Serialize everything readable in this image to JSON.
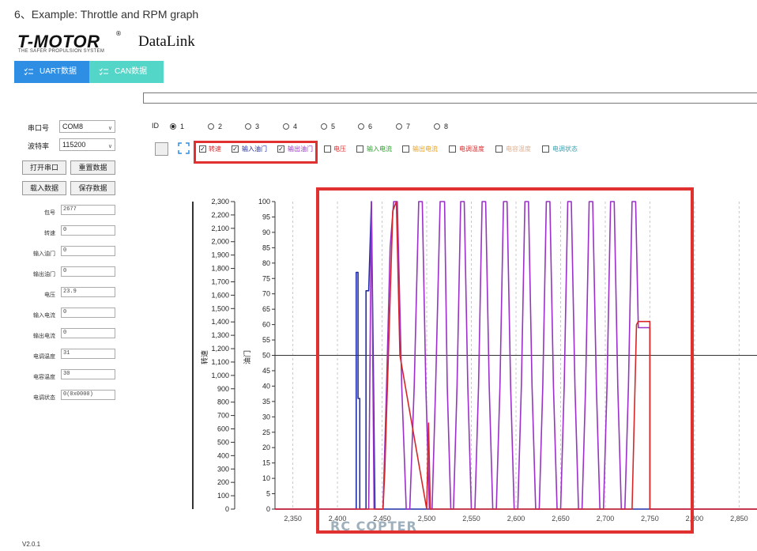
{
  "heading": "6、Example: Throttle and RPM graph",
  "brand": {
    "logo_text": "T-MOTOR",
    "logo_tagline": "THE SAFER PROPULSION SYSTEM",
    "registered": "®",
    "app_title": "DataLink"
  },
  "tabs": [
    {
      "label": "UART数据",
      "color": "#2e8ee3"
    },
    {
      "label": "CAN数据",
      "color": "#53d5c7"
    }
  ],
  "serial": {
    "port_label": "串口号",
    "port_value": "COM8",
    "baud_label": "波特率",
    "baud_value": "115200"
  },
  "buttons": {
    "open_port": "打开串口",
    "reset_data": "重置数据",
    "load_data": "载入数据",
    "save_data": "保存数据"
  },
  "fields": [
    {
      "label": "包号",
      "value": "2677"
    },
    {
      "label": "转速",
      "value": "0"
    },
    {
      "label": "输入油门",
      "value": "0"
    },
    {
      "label": "输出油门",
      "value": "0"
    },
    {
      "label": "电压",
      "value": "23.9"
    },
    {
      "label": "输入电流",
      "value": "0"
    },
    {
      "label": "输出电流",
      "value": "0"
    },
    {
      "label": "电调温度",
      "value": "31"
    },
    {
      "label": "电容温度",
      "value": "30"
    },
    {
      "label": "电调状态",
      "value": "0(0x0000)"
    }
  ],
  "id_selector": {
    "label": "ID",
    "options": [
      "1",
      "2",
      "3",
      "4",
      "5",
      "6",
      "7",
      "8"
    ],
    "selected": "1"
  },
  "channels": [
    {
      "label": "转速",
      "checked": true,
      "color": "#d62728"
    },
    {
      "label": "输入油门",
      "checked": true,
      "color": "#1f2ea8"
    },
    {
      "label": "输出油门",
      "checked": true,
      "color": "#9b30c8"
    },
    {
      "label": "电压",
      "checked": false,
      "color": "#e03030"
    },
    {
      "label": "输入电流",
      "checked": false,
      "color": "#2ca02c"
    },
    {
      "label": "输出电流",
      "checked": false,
      "color": "#e8a020"
    },
    {
      "label": "电调温度",
      "checked": false,
      "color": "#d03030"
    },
    {
      "label": "电容温度",
      "checked": false,
      "color": "#e0b090"
    },
    {
      "label": "电调状态",
      "checked": false,
      "color": "#3aa0b0"
    }
  ],
  "version": "V2.0.1",
  "watermark": "RC COPTER",
  "highlight_color": "#e03030",
  "chart_data": {
    "type": "line",
    "xlabel": "",
    "ylabel_left": "转速",
    "ylabel_right": "油门",
    "xlim": [
      2330,
      2870
    ],
    "x_ticks": [
      2350,
      2400,
      2450,
      2500,
      2550,
      2600,
      2650,
      2700,
      2750,
      2800,
      2850
    ],
    "x_tick_labels": [
      "2,350",
      "2,400",
      "2,450",
      "2,500",
      "2,550",
      "2,600",
      "2,650",
      "2,700",
      "2,750",
      "2,800",
      "2,850"
    ],
    "ylim_left": [
      0,
      2300
    ],
    "y_left_ticks": [
      0,
      100,
      200,
      300,
      400,
      500,
      600,
      700,
      800,
      900,
      1000,
      1100,
      1200,
      1300,
      1400,
      1500,
      1600,
      1700,
      1800,
      1900,
      2000,
      2100,
      2200,
      2300
    ],
    "y_left_tick_labels": [
      "0",
      "100",
      "200",
      "300",
      "400",
      "500",
      "600",
      "700",
      "800",
      "900",
      "1,000",
      "1,100",
      "1,200",
      "1,300",
      "1,400",
      "1,500",
      "1,600",
      "1,700",
      "1,800",
      "1,900",
      "2,000",
      "2,100",
      "2,200",
      "2,300"
    ],
    "ylim_right": [
      0,
      100
    ],
    "y_right_ticks": [
      0,
      5,
      10,
      15,
      20,
      25,
      30,
      35,
      40,
      45,
      50,
      55,
      60,
      65,
      70,
      75,
      80,
      85,
      90,
      95,
      100
    ],
    "y_right_tick_labels": [
      "0",
      "5",
      "10",
      "15",
      "20",
      "25",
      "30",
      "35",
      "40",
      "45",
      "50",
      "55",
      "60",
      "65",
      "70",
      "75",
      "80",
      "85",
      "90",
      "95",
      "100"
    ],
    "reference_line_right": 50,
    "series": [
      {
        "name": "输入油门",
        "color": "#1f2ea8",
        "x": [
          2330,
          2421,
          2421,
          2423,
          2423,
          2425,
          2425,
          2432,
          2432,
          2435,
          2438,
          2440,
          2442,
          2445,
          2448,
          2451,
          2470,
          2750,
          2750,
          2870
        ],
        "y": [
          0,
          0,
          77,
          77,
          36,
          36,
          0,
          0,
          71,
          71,
          100,
          50,
          0,
          0,
          0,
          0,
          0,
          0,
          0,
          0
        ]
      },
      {
        "name": "输出油门",
        "color": "#9b30c8",
        "x": [
          2330,
          2435,
          2438,
          2441,
          2444,
          2447,
          2451,
          2455,
          2459,
          2463,
          2467,
          2472,
          2477,
          2481,
          2486,
          2491,
          2495,
          2499,
          2503,
          2506,
          2510,
          2515,
          2520,
          2523,
          2527,
          2530,
          2534,
          2538,
          2542,
          2546,
          2550,
          2554,
          2558,
          2562,
          2566,
          2570,
          2574,
          2578,
          2582,
          2586,
          2590,
          2594,
          2598,
          2602,
          2606,
          2610,
          2614,
          2618,
          2622,
          2626,
          2630,
          2634,
          2638,
          2642,
          2646,
          2650,
          2654,
          2658,
          2662,
          2666,
          2670,
          2674,
          2678,
          2682,
          2686,
          2690,
          2694,
          2698,
          2702,
          2706,
          2710,
          2714,
          2718,
          2722,
          2726,
          2730,
          2734,
          2737,
          2750,
          2750,
          2870
        ],
        "y": [
          0,
          0,
          100,
          0,
          0,
          0,
          0,
          40,
          85,
          100,
          100,
          40,
          0,
          0,
          40,
          100,
          100,
          40,
          0,
          0,
          40,
          100,
          100,
          40,
          0,
          0,
          40,
          100,
          100,
          40,
          0,
          0,
          40,
          100,
          100,
          40,
          0,
          0,
          40,
          100,
          100,
          40,
          0,
          0,
          40,
          100,
          100,
          40,
          0,
          0,
          40,
          100,
          100,
          40,
          0,
          0,
          40,
          100,
          100,
          40,
          0,
          0,
          40,
          100,
          100,
          40,
          0,
          0,
          40,
          100,
          100,
          40,
          0,
          0,
          40,
          100,
          100,
          59,
          59,
          0,
          0
        ]
      },
      {
        "name": "转速",
        "color": "#d62728",
        "x": [
          2330,
          2449,
          2451,
          2453,
          2457,
          2462,
          2466,
          2470,
          2500,
          2502,
          2504,
          2730,
          2735,
          2737,
          2750,
          2750,
          2870
        ],
        "y": [
          0,
          0,
          0,
          12,
          50,
          97,
          100,
          50,
          0,
          28,
          0,
          0,
          60,
          61,
          61,
          0,
          0
        ]
      }
    ]
  }
}
